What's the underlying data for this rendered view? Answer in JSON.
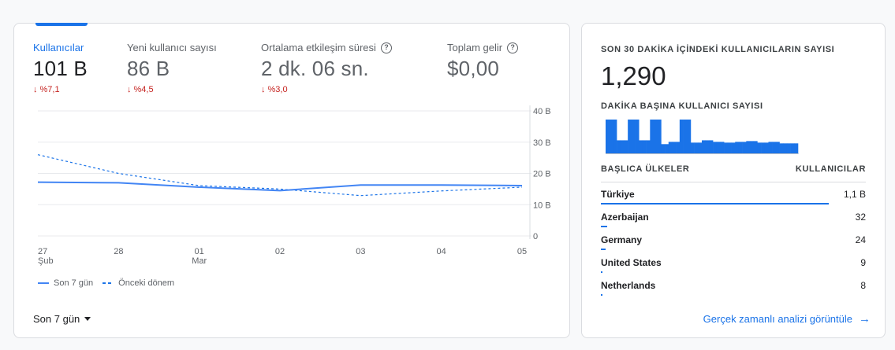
{
  "metrics": [
    {
      "label": "Kullanıcılar",
      "value": "101 B",
      "change": "%7,1"
    },
    {
      "label": "Yeni kullanıcı sayısı",
      "value": "86 B",
      "change": "%4,5"
    },
    {
      "label": "Ortalama etkileşim süresi",
      "value": "2 dk. 06 sn.",
      "change": "%3,0"
    },
    {
      "label": "Toplam gelir",
      "value": "$0,00",
      "change": ""
    }
  ],
  "chart_data": {
    "type": "line",
    "x": [
      "27 Şub",
      "28",
      "01 Mar",
      "02",
      "03",
      "04",
      "05"
    ],
    "x_ticks": [
      [
        "27",
        "Şub"
      ],
      [
        "28",
        ""
      ],
      [
        "01",
        "Mar"
      ],
      [
        "02",
        ""
      ],
      [
        "03",
        ""
      ],
      [
        "04",
        ""
      ],
      [
        "05",
        ""
      ]
    ],
    "y_ticks": [
      "40 B",
      "30 B",
      "20 B",
      "10 B",
      "0"
    ],
    "ylim": [
      0,
      40000
    ],
    "series": [
      {
        "name": "Son 7 gün",
        "style": "solid",
        "color": "#4285f4",
        "values": [
          17200,
          17000,
          15600,
          14500,
          16300,
          16300,
          16100
        ]
      },
      {
        "name": "Önceki dönem",
        "style": "dashed",
        "color": "#1a73e8",
        "values": [
          26000,
          20000,
          16100,
          15000,
          12900,
          14400,
          15600
        ]
      }
    ],
    "legend_position": "bottom-left",
    "grid": true
  },
  "date_range": "Son 7 gün",
  "realtime": {
    "title": "SON 30 DAKİKA İÇİNDEKİ KULLANICILARIN SAYISI",
    "count": "1,290",
    "per_minute_title": "DAKİKA BAŞINA KULLANICI SAYISI",
    "per_minute": [
      45,
      45,
      45,
      18,
      18,
      18,
      45,
      45,
      45,
      18,
      18,
      18,
      45,
      45,
      45,
      13,
      13,
      16,
      16,
      16,
      45,
      45,
      45,
      15,
      15,
      15,
      18,
      18,
      18,
      16,
      16,
      16,
      15,
      15,
      15,
      16,
      16,
      16,
      17,
      17,
      17,
      15,
      15,
      15,
      16,
      16,
      16,
      14,
      14,
      14,
      14,
      14
    ],
    "per_minute_max": 45,
    "col_country": "BAŞLICA ÜLKELER",
    "col_users": "KULLANICILAR",
    "rows": [
      {
        "country": "Türkiye",
        "users": "1,1 B",
        "share": 0.86
      },
      {
        "country": "Azerbaijan",
        "users": "32",
        "share": 0.025
      },
      {
        "country": "Germany",
        "users": "24",
        "share": 0.019
      },
      {
        "country": "United States",
        "users": "9",
        "share": 0.007
      },
      {
        "country": "Netherlands",
        "users": "8",
        "share": 0.006
      }
    ],
    "link": "Gerçek zamanlı analizi görüntüle"
  }
}
